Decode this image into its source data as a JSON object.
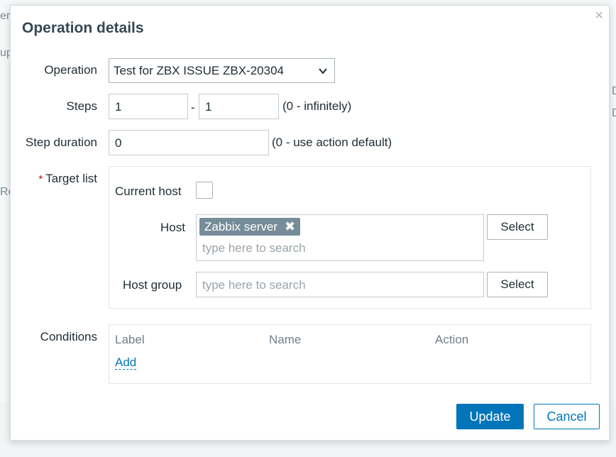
{
  "background": {
    "fragments": [
      "er",
      "up",
      "Re",
      "D",
      "D"
    ]
  },
  "dialog": {
    "title": "Operation details",
    "close_glyph": "×",
    "operation": {
      "label": "Operation",
      "selected": "Test for ZBX ISSUE ZBX-20304"
    },
    "steps": {
      "label": "Steps",
      "from": "1",
      "separator": "-",
      "to": "1",
      "hint": "(0 - infinitely)"
    },
    "step_duration": {
      "label": "Step duration",
      "value": "0",
      "hint": "(0 - use action default)"
    },
    "target_list": {
      "required_marker": "*",
      "label": "Target list",
      "current_host_label": "Current host",
      "current_host_checked": false,
      "host_label": "Host",
      "host_tags": [
        "Zabbix server"
      ],
      "host_tag_remove": "✖",
      "host_placeholder": "type here to search",
      "host_select_label": "Select",
      "host_group_label": "Host group",
      "host_group_placeholder": "type here to search",
      "host_group_select_label": "Select"
    },
    "conditions": {
      "label": "Conditions",
      "columns": [
        "Label",
        "Name",
        "Action"
      ],
      "add_label": "Add"
    },
    "footer": {
      "update_label": "Update",
      "cancel_label": "Cancel"
    }
  },
  "colors": {
    "primary": "#0275b8",
    "tag_bg": "#768d99",
    "required": "#d40000"
  }
}
